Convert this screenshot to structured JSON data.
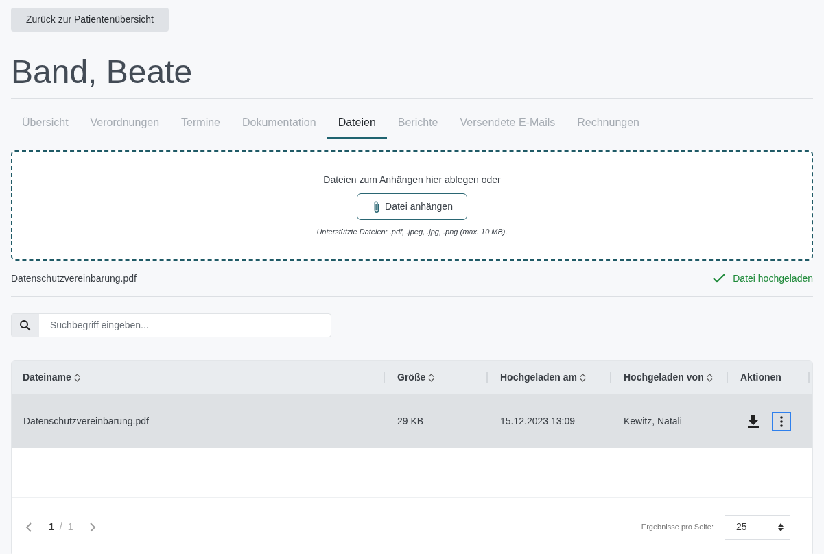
{
  "back_button": "Zurück zur Patientenübersicht",
  "patient_name": "Band, Beate",
  "tabs": [
    {
      "label": "Übersicht",
      "selected": false
    },
    {
      "label": "Verordnungen",
      "selected": false
    },
    {
      "label": "Termine",
      "selected": false
    },
    {
      "label": "Dokumentation",
      "selected": false
    },
    {
      "label": "Dateien",
      "selected": true
    },
    {
      "label": "Berichte",
      "selected": false
    },
    {
      "label": "Versendete E-Mails",
      "selected": false
    },
    {
      "label": "Rechnungen",
      "selected": false
    }
  ],
  "dropzone": {
    "prompt": "Dateien zum Anhängen hier ablegen oder",
    "button": "Datei anhängen",
    "hint": "Unterstützte Dateien: .pdf, .jpeg, .jpg, .png (max. 10 MB)."
  },
  "uploads": [
    {
      "name": "Datenschutzvereinbarung.pdf",
      "uploaded": true,
      "status_text": "Datei hochgeladen"
    }
  ],
  "search": {
    "placeholder": "Suchbegriff eingeben..."
  },
  "table": {
    "columns": [
      {
        "label": "Dateiname",
        "sortable": true
      },
      {
        "label": "Größe",
        "sortable": true
      },
      {
        "label": "Hochgeladen am",
        "sortable": true
      },
      {
        "label": "Hochgeladen von",
        "sortable": true
      },
      {
        "label": "Aktionen",
        "sortable": false
      }
    ],
    "rows": [
      {
        "cells": [
          "Datenschutzvereinbarung.pdf",
          "29 KB",
          "15.12.2023 13:09",
          "Kewitz, Natali"
        ],
        "selected": true
      }
    ]
  },
  "pagination": {
    "current": "1",
    "separator": "/",
    "total": "1",
    "per_page_label": "Ergebnisse pro Seite:",
    "per_page": "25"
  }
}
